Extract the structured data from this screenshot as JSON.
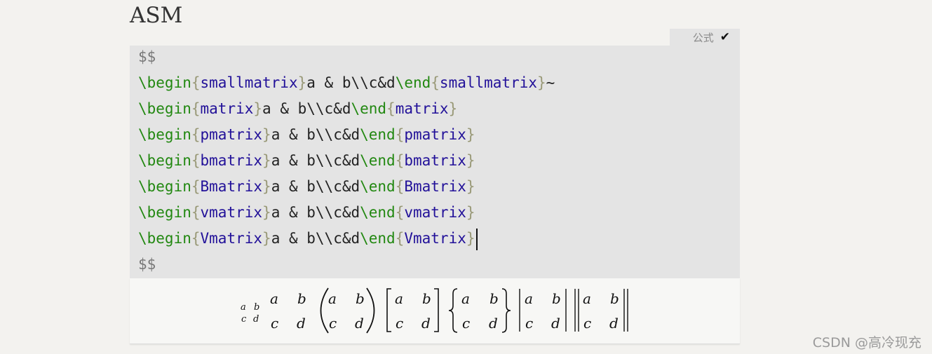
{
  "heading": "ASM",
  "code_block": {
    "language_tag": "公式",
    "check_icon": "check-icon",
    "open_delim": "$$",
    "close_delim": "$$",
    "lines": [
      {
        "kw1": "\\begin",
        "env1": "smallmatrix",
        "body": "a & b\\\\c&d",
        "kw2": "\\end",
        "env2": "smallmatrix",
        "trail": "~"
      },
      {
        "kw1": "\\begin",
        "env1": "matrix",
        "body": "a & b\\\\c&d",
        "kw2": "\\end",
        "env2": "matrix",
        "trail": ""
      },
      {
        "kw1": "\\begin",
        "env1": "pmatrix",
        "body": "a & b\\\\c&d",
        "kw2": "\\end",
        "env2": "pmatrix",
        "trail": ""
      },
      {
        "kw1": "\\begin",
        "env1": "bmatrix",
        "body": "a & b\\\\c&d",
        "kw2": "\\end",
        "env2": "bmatrix",
        "trail": ""
      },
      {
        "kw1": "\\begin",
        "env1": "Bmatrix",
        "body": "a & b\\\\c&d",
        "kw2": "\\end",
        "env2": "Bmatrix",
        "trail": ""
      },
      {
        "kw1": "\\begin",
        "env1": "vmatrix",
        "body": "a & b\\\\c&d",
        "kw2": "\\end",
        "env2": "vmatrix",
        "trail": ""
      },
      {
        "kw1": "\\begin",
        "env1": "Vmatrix",
        "body": "a & b\\\\c&d",
        "kw2": "\\end",
        "env2": "Vmatrix",
        "trail": ""
      }
    ]
  },
  "preview": {
    "cells": [
      "a",
      "b",
      "c",
      "d"
    ]
  },
  "watermark": "CSDN @高冷现充",
  "colors": {
    "keyword": "#228811",
    "environment": "#221199",
    "bracket": "#999977",
    "code_background": "#e4e4e4",
    "page_background": "#f3f2ef"
  }
}
